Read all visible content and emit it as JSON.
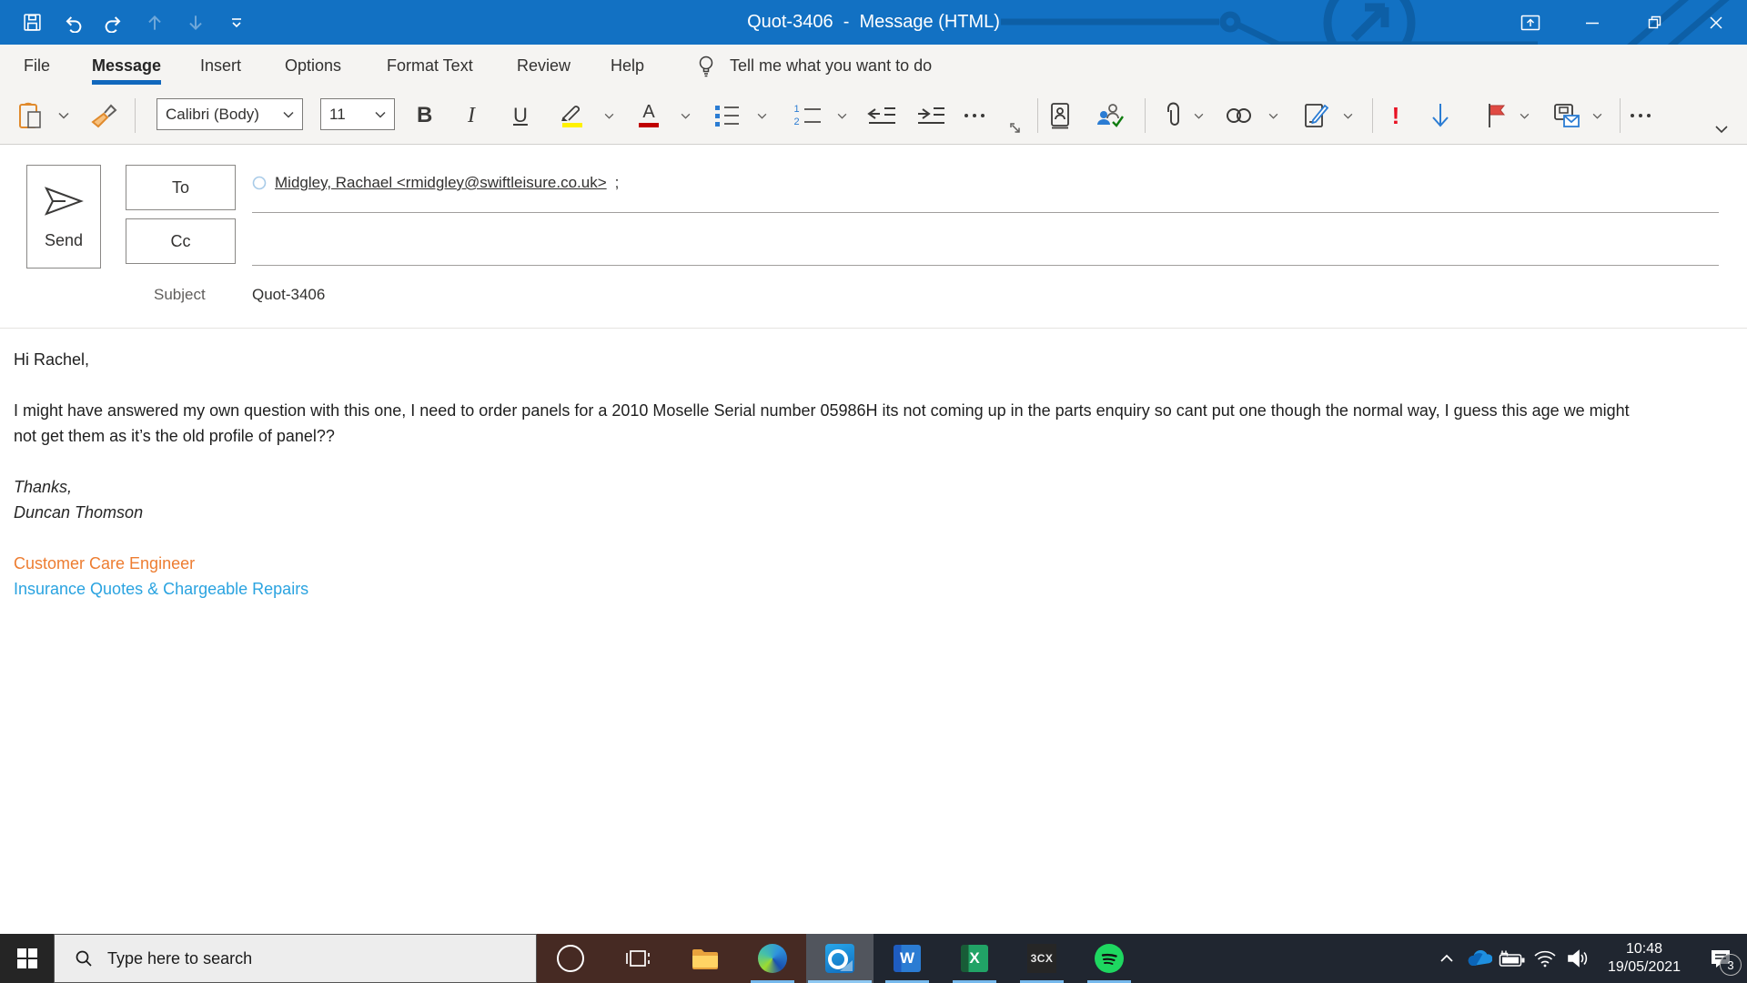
{
  "window": {
    "title": "Quot-3406  -  Message (HTML)"
  },
  "ribbon": {
    "tabs": [
      {
        "label": "File"
      },
      {
        "label": "Message",
        "active": true
      },
      {
        "label": "Insert"
      },
      {
        "label": "Options"
      },
      {
        "label": "Format Text"
      },
      {
        "label": "Review"
      },
      {
        "label": "Help"
      }
    ],
    "tell_me": "Tell me what you want to do",
    "font_name": "Calibri (Body)",
    "font_size": "11",
    "bold_glyph": "B",
    "italic_glyph": "I",
    "underline_glyph": "U",
    "font_color_glyph": "A",
    "numbering_one": "1",
    "numbering_two": "2",
    "high_importance_glyph": "!"
  },
  "compose": {
    "send": "Send",
    "to": "To",
    "cc": "Cc",
    "subject_label": "Subject",
    "subject": "Quot-3406",
    "recipient": "Midgley, Rachael <rmidgley@swiftleisure.co.uk>",
    "recipient_separator": ";"
  },
  "message": {
    "greeting": "Hi Rachel,",
    "body": "I might have answered my own question with this one, I need to order panels for a 2010 Moselle Serial number 05986H its not coming up in the parts enquiry so cant put one though the normal way, I guess this age we might not get them as it’s the old profile of panel??",
    "sign_off": "Thanks,",
    "sender": "Duncan Thomson",
    "signature_role": "Customer Care Engineer",
    "signature_team": "Insurance Quotes & Chargeable Repairs"
  },
  "taskbar": {
    "search_placeholder": "Type here to search",
    "outlook_glyph": "O",
    "word_glyph": "W",
    "excel_glyph": "X",
    "threecx_label": "3CX",
    "tray": {
      "time": "10:48",
      "date": "19/05/2021",
      "notification_count": "3"
    }
  },
  "colors": {
    "titlebar_blue": "#1271C3",
    "tab_accent_blue": "#1168BD",
    "highlight_yellow": "#FFF100",
    "font_color_red": "#C00000",
    "importance_red": "#E81123",
    "flag_red": "#D13438",
    "signature_role_orange": "#ED7D31",
    "signature_team_blue": "#2AA3E0",
    "spotify_green": "#1ED760",
    "taskbar_running_underline": "#76B9ED"
  },
  "icons": {
    "quick_access": [
      "save-icon",
      "undo-icon",
      "redo-icon",
      "move-up-icon",
      "move-down-icon",
      "customize-qat-icon"
    ],
    "window_controls": [
      "ribbon-display-options-icon",
      "minimize-icon",
      "restore-icon",
      "close-icon"
    ],
    "toolbar": [
      "paste-icon",
      "format-painter-icon",
      "highlight-icon",
      "font-color-icon",
      "bullets-icon",
      "numbering-icon",
      "decrease-indent-icon",
      "increase-indent-icon",
      "overflow-dots-icon",
      "dialog-launcher-icon",
      "address-book-icon",
      "check-names-icon",
      "attach-file-icon",
      "link-icon",
      "signature-icon",
      "high-importance-icon",
      "low-importance-icon",
      "follow-up-flag-icon",
      "templates-icon",
      "collapse-ribbon-icon"
    ],
    "tray": [
      "hidden-icons-chevron-icon",
      "onedrive-cloud-icon",
      "battery-icon",
      "wifi-icon",
      "volume-icon",
      "action-center-icon"
    ]
  }
}
